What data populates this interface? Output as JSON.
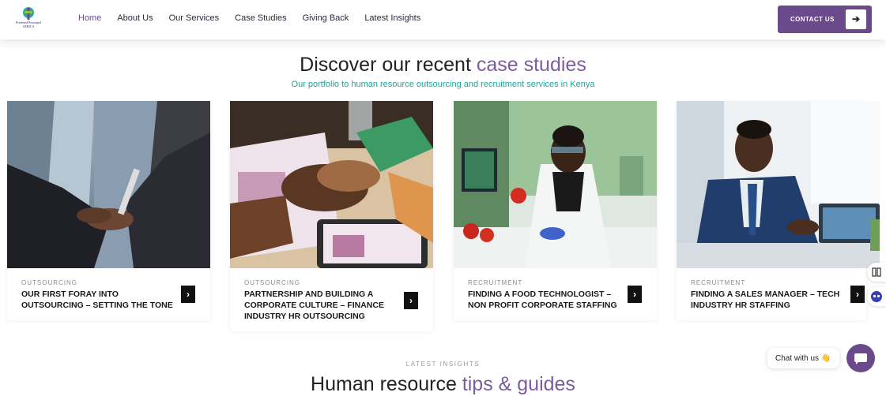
{
  "header": {
    "logo_text": [
      "Preferred Personnel",
      "AFRICA"
    ],
    "nav": [
      {
        "label": "Home",
        "active": true
      },
      {
        "label": "About Us",
        "active": false
      },
      {
        "label": "Our Services",
        "active": false
      },
      {
        "label": "Case Studies",
        "active": false
      },
      {
        "label": "Giving Back",
        "active": false
      },
      {
        "label": "Latest Insights",
        "active": false
      }
    ],
    "contact_label": "CONTACT US",
    "contact_icon": "arrow-right-icon"
  },
  "case_studies": {
    "title_plain": "Discover our recent ",
    "title_highlight": "case studies",
    "subtitle": "Our portfolio to human resource outsourcing and recruitment services in Kenya",
    "cards": [
      {
        "category": "OUTSOURCING",
        "title": "OUR FIRST FORAY INTO OUTSOURCING – SETTING THE TONE",
        "image": "business-handshake-photo"
      },
      {
        "category": "OUTSOURCING",
        "title": "PARTNERSHIP AND BUILDING A CORPORATE CULTURE – FINANCE INDUSTRY HR OUTSOURCING",
        "image": "team-hands-stacked-photo"
      },
      {
        "category": "RECRUITMENT",
        "title": "FINDING A FOOD TECHNOLOGIST – NON PROFIT CORPORATE STAFFING",
        "image": "lab-food-technologist-photo"
      },
      {
        "category": "RECRUITMENT",
        "title": "FINDING A SALES MANAGER – TECH INDUSTRY HR STAFFING",
        "image": "smiling-businessman-photo"
      }
    ]
  },
  "latest": {
    "label": "LATEST INSIGHTS",
    "title_plain": "Human resource ",
    "title_highlight": "tips & guides"
  },
  "chat": {
    "label": "Chat with us 👋",
    "button_icon": "chat-icon"
  },
  "colors": {
    "brand_purple": "#6b4a8c",
    "accent_teal": "#1aa79a",
    "heading_purple": "#7b5c9e"
  }
}
